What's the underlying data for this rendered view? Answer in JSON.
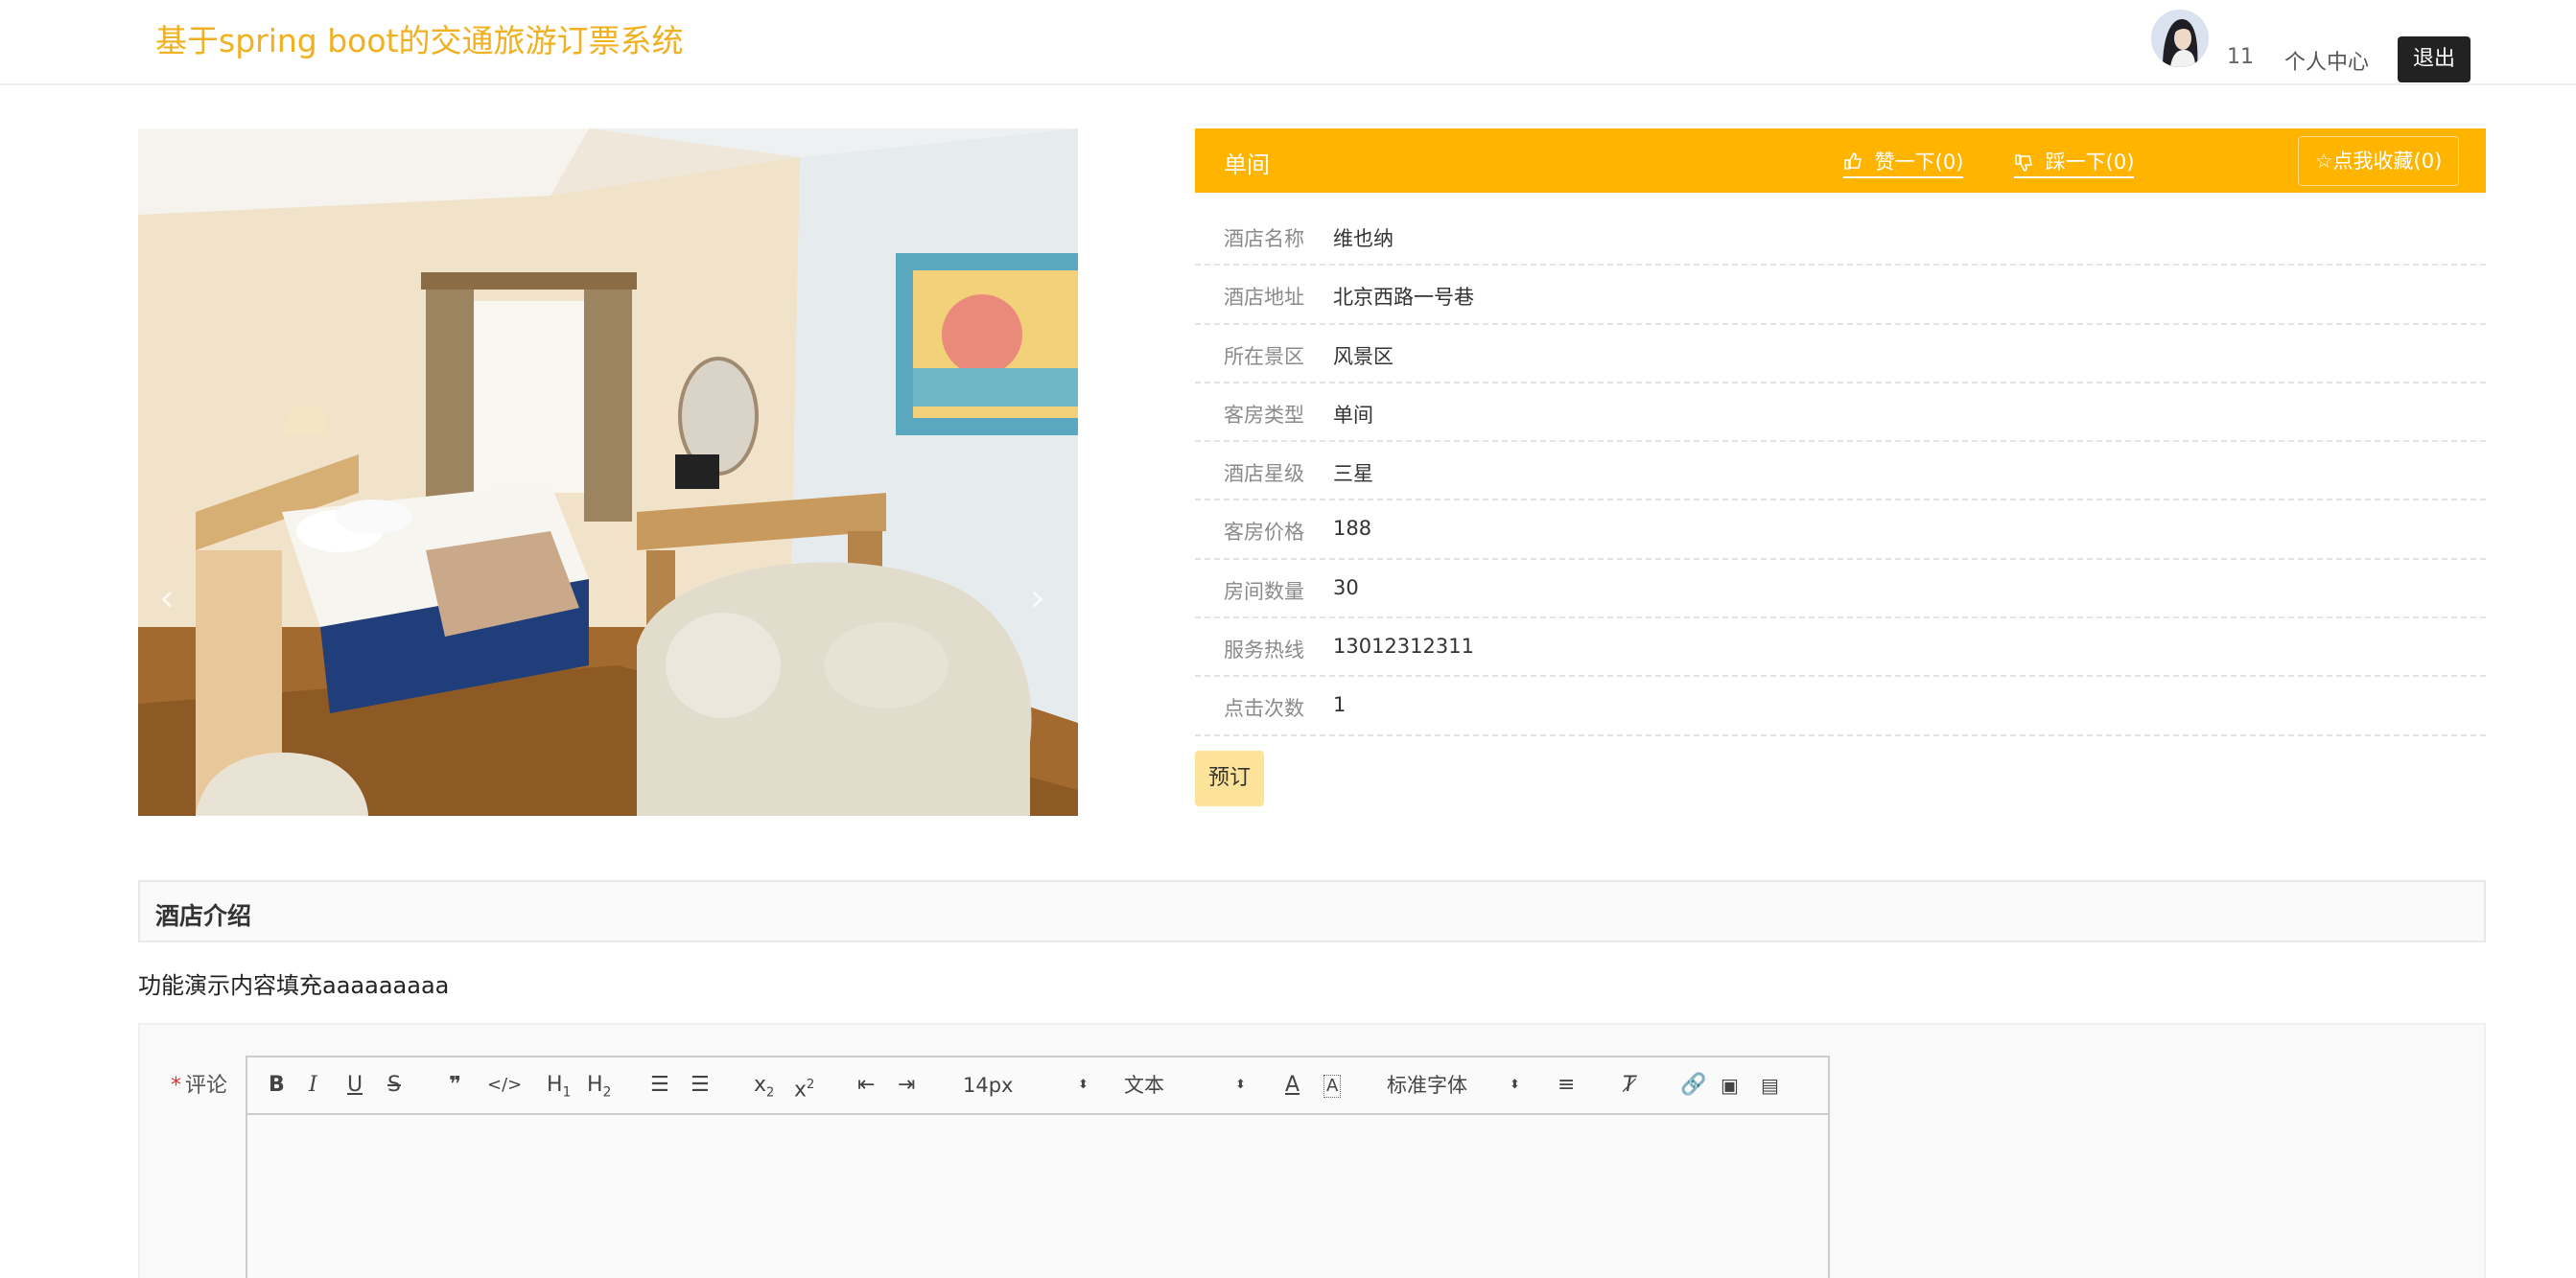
{
  "header": {
    "site_title": "基于spring boot的交通旅游订票系统",
    "username": "11",
    "center_label": "个人中心",
    "logout_label": "退出"
  },
  "carousel": {
    "prev_glyph": "‹",
    "next_glyph": "›"
  },
  "detail": {
    "room_title": "单间",
    "like_label": "赞一下(0)",
    "dislike_label": "踩一下(0)",
    "favorite_label": "点我收藏(0)",
    "rows": [
      {
        "label": "酒店名称",
        "value": "维也纳"
      },
      {
        "label": "酒店地址",
        "value": "北京西路一号巷"
      },
      {
        "label": "所在景区",
        "value": "风景区"
      },
      {
        "label": "客房类型",
        "value": "单间"
      },
      {
        "label": "酒店星级",
        "value": "三星"
      },
      {
        "label": "客房价格",
        "value": "188"
      },
      {
        "label": "房间数量",
        "value": "30"
      },
      {
        "label": "服务热线",
        "value": "13012312311"
      },
      {
        "label": "点击次数",
        "value": "1"
      }
    ],
    "book_label": "预订"
  },
  "intro": {
    "title": "酒店介绍",
    "text": "功能演示内容填充aaaaaaaaa"
  },
  "comment": {
    "required_mark": "*",
    "label": "评论",
    "toolbar": {
      "size_value": "14px",
      "header_value": "文本",
      "font_value": "标准字体"
    }
  },
  "colors": {
    "brand": "#f0b020",
    "header_bar": "#ffb400",
    "book_button": "#fde39a",
    "logout": "#222222"
  }
}
